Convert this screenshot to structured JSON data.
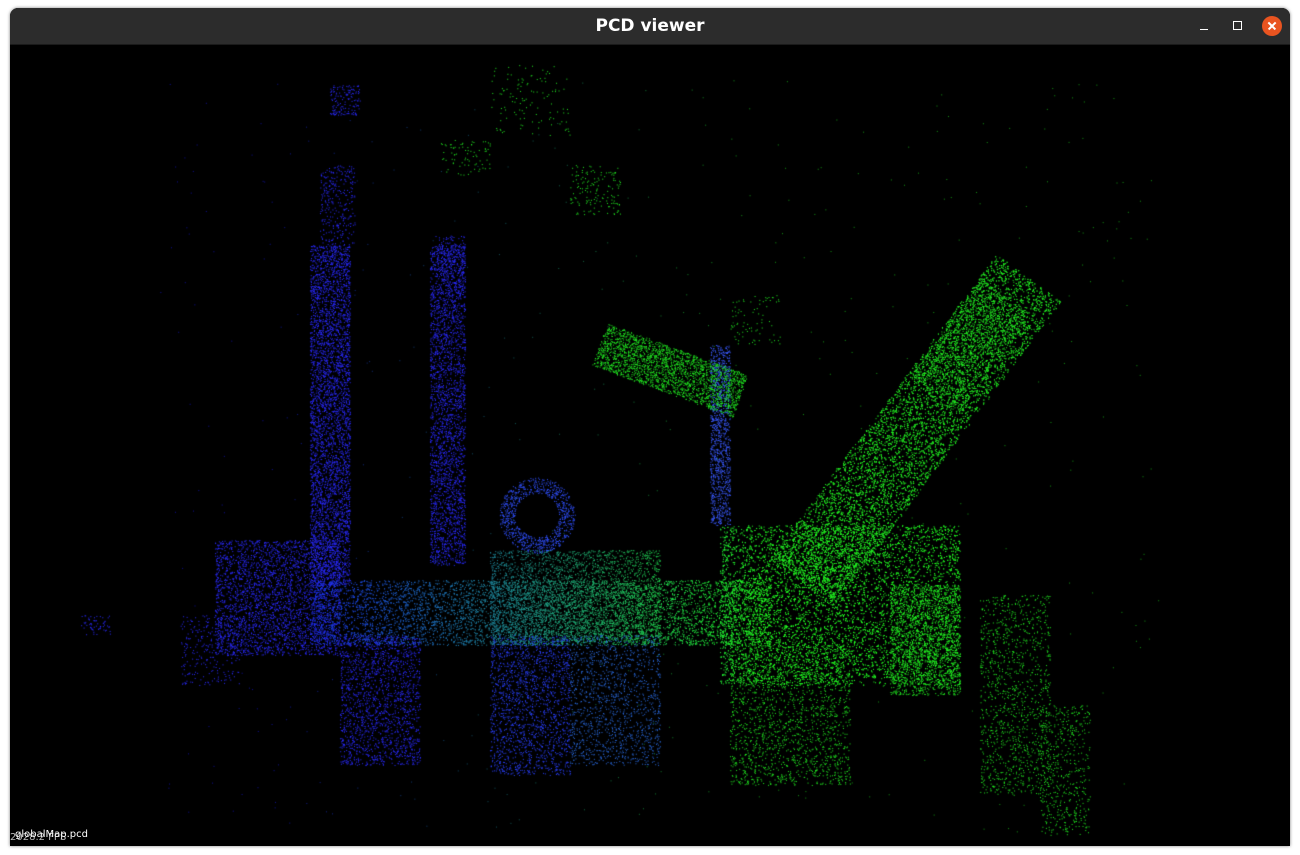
{
  "window": {
    "title": "PCD viewer",
    "controls": {
      "minimize": "minimize-icon",
      "maximize": "maximize-icon",
      "close": "close-icon"
    }
  },
  "viewer": {
    "background_color": "#000000",
    "point_colors": {
      "low": "#1a1aff",
      "high": "#22ff22"
    },
    "fps_text": "2028.2 FPS",
    "cloud_name": "globalMap.pcd"
  },
  "colors": {
    "titlebar": "#2c2c2c",
    "close_button": "#e95420"
  }
}
